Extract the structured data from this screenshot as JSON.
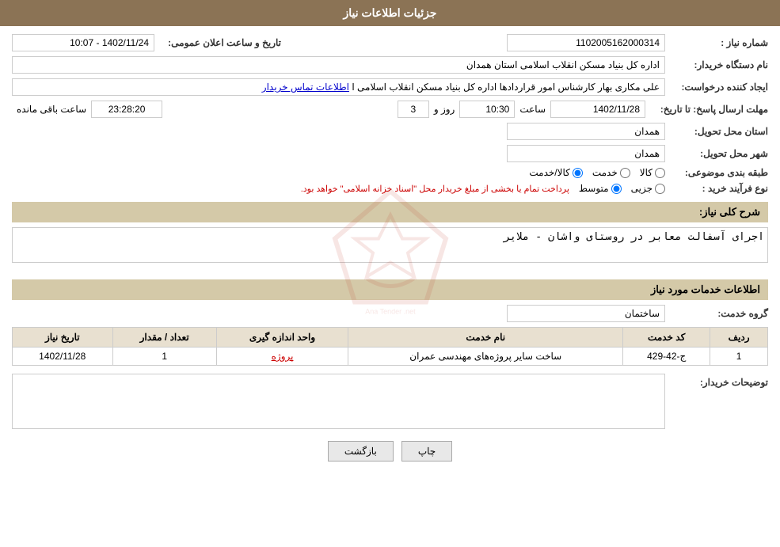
{
  "header": {
    "title": "جزئیات اطلاعات نیاز"
  },
  "fields": {
    "shomareNiaz_label": "شماره نیاز :",
    "shomareNiaz_value": "1102005162000314",
    "namDastgah_label": "نام دستگاه خریدار:",
    "namDastgah_value": "اداره کل بنیاد مسکن انقلاب اسلامی استان همدان",
    "eijadKonande_label": "ایجاد کننده درخواست:",
    "eijadKonande_value": "علی مکاری بهار کارشناس امور قراردادها اداره کل بنیاد مسکن انقلاب اسلامی ا",
    "eijadKonande_link": "اطلاعات تماس خریدار",
    "mohlatErsal_label": "مهلت ارسال پاسخ: تا تاریخ:",
    "date_value": "1402/11/28",
    "saat_label": "ساعت",
    "saat_value": "10:30",
    "roz_label": "روز و",
    "roz_value": "3",
    "remaining_value": "23:28:20",
    "remaining_label": "ساعت باقی مانده",
    "ostanMahale_label": "استان محل تحویل:",
    "ostanMahale_value": "همدان",
    "shahrMahale_label": "شهر محل تحویل:",
    "shahrMahale_value": "همدان",
    "tabaghebandi_label": "طبقه بندی موضوعی:",
    "tabaghebandi_kala": "کالا",
    "tabaghebandi_khedmat": "خدمت",
    "tabaghebandi_kala_khedmat": "کالا/خدمت",
    "noveFarayand_label": "نوع فرآیند خرید :",
    "noveFarayand_jazzi": "جزیی",
    "noveFarayand_motavasset": "متوسط",
    "noveFarayand_note": "پرداخت تمام یا بخشی از مبلغ خریدار محل \"اسناد خزانه اسلامی\" خواهد بود.",
    "sharhKolli_label": "شرح کلی نیاز:",
    "sharhKolli_value": "اجرای آسفالت معابر در روستای واشان - ملایر",
    "khadamat_label": "اطلاعات خدمات مورد نیاز",
    "grohKhadamat_label": "گروه خدمت:",
    "grohKhadamat_value": "ساختمان",
    "table": {
      "headers": [
        "ردیف",
        "کد خدمت",
        "نام خدمت",
        "واحد اندازه گیری",
        "تعداد / مقدار",
        "تاریخ نیاز"
      ],
      "rows": [
        {
          "radif": "1",
          "kodKhedmat": "ج-42-429",
          "namKhedmat": "ساخت سایر پروژه‌های مهندسی عمران",
          "vahed": "پروژه",
          "tedad": "1",
          "tarikh": "1402/11/28"
        }
      ]
    },
    "tosifat_label": "توضیحات خریدار:",
    "tosifat_value": "",
    "taarikh_pub_label": "تاریخ و ساعت اعلان عمومی:",
    "taarikh_pub_value": "1402/11/24 - 10:07"
  },
  "buttons": {
    "chap": "چاپ",
    "bazgasht": "بازگشت"
  }
}
